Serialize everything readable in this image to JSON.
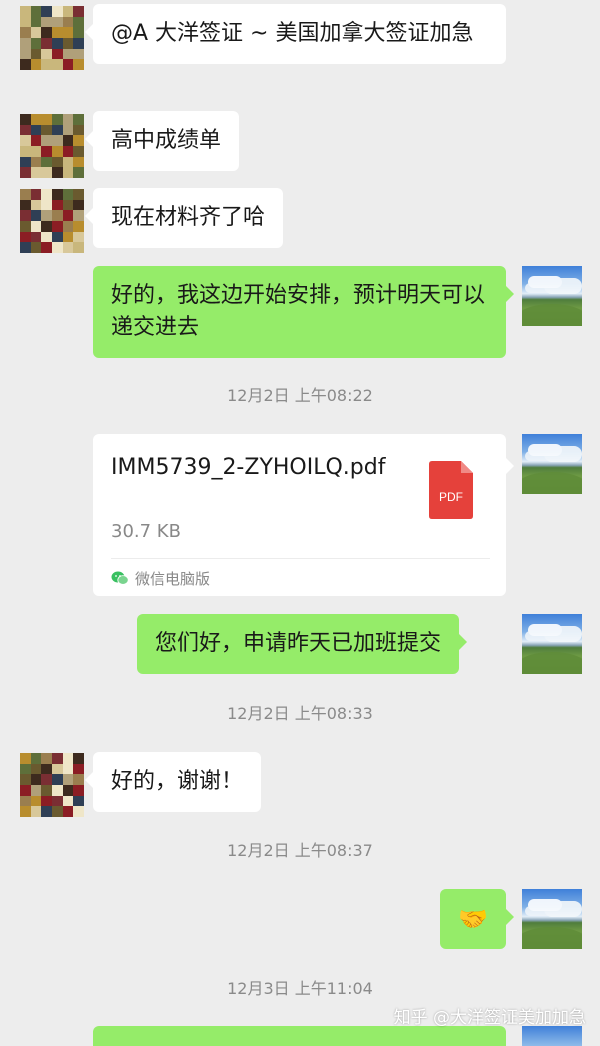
{
  "messages": {
    "m1": {
      "text": "@A 大洋签证 ~ 美国加拿大签证加急"
    },
    "m2": {
      "text": "高中成绩单"
    },
    "m3": {
      "text": "现在材料齐了哈"
    },
    "m4": {
      "text": "好的，我这边开始安排，预计明天可以递交进去"
    },
    "t1": {
      "text": "12月2日 上午08:22"
    },
    "file": {
      "name": "IMM5739_2-ZYHOILQ.pdf",
      "size": "30.7 KB",
      "icon_label": "PDF",
      "footer": "微信电脑版"
    },
    "m5": {
      "text": "您们好，申请昨天已加班提交"
    },
    "t2": {
      "text": "12月2日 上午08:33"
    },
    "m6": {
      "text": "好的，谢谢！"
    },
    "t3": {
      "text": "12月2日 上午08:37"
    },
    "m7": {
      "emoji": "🤝"
    },
    "t4": {
      "text": "12月3日 上午11:04"
    }
  },
  "watermark": "知乎 @大洋签证美加加急",
  "colors": {
    "background": "#ededed",
    "sent_bubble": "#95ec69",
    "received_bubble": "#ffffff",
    "pdf_red": "#e5413b"
  }
}
